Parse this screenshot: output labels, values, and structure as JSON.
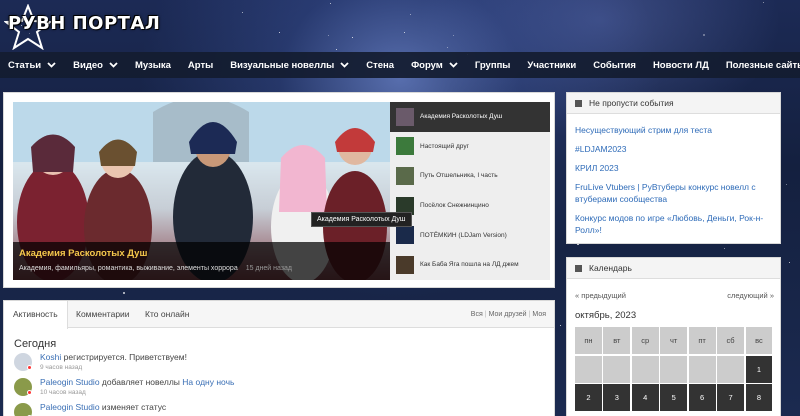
{
  "logo": {
    "text": "РУВН ПОРТАЛ"
  },
  "nav": [
    {
      "label": "Статьи",
      "dropdown": true
    },
    {
      "label": "Видео",
      "dropdown": true
    },
    {
      "label": "Музыка",
      "dropdown": false
    },
    {
      "label": "Арты",
      "dropdown": false
    },
    {
      "label": "Визуальные новеллы",
      "dropdown": true
    },
    {
      "label": "Стена",
      "dropdown": false
    },
    {
      "label": "Форум",
      "dropdown": true
    },
    {
      "label": "Группы",
      "dropdown": false
    },
    {
      "label": "Участники",
      "dropdown": false
    },
    {
      "label": "События",
      "dropdown": false
    },
    {
      "label": "Новости ЛД",
      "dropdown": false
    },
    {
      "label": "Полезные сайты",
      "dropdown": true
    }
  ],
  "slider": {
    "title": "Академия Расколотых Душ",
    "tags": "Академия, фамильяры, романтика, выживание, элементы хоррора",
    "time": "15 дней назад",
    "tooltip": "Академия Расколотых Душ",
    "thumbs": [
      {
        "label": "Академия Расколотых Душ",
        "active": true,
        "color": "#6a5a6a"
      },
      {
        "label": "Настоящий друг",
        "active": false,
        "color": "#3c7a3c"
      },
      {
        "label": "Путь Отшельника, I часть",
        "active": false,
        "color": "#5a6a4a"
      },
      {
        "label": "Посёлок Снежнинцино",
        "active": false,
        "color": "#2a3a2a"
      },
      {
        "label": "ПОТЁМКИН (LDJam Version)",
        "active": false,
        "color": "#1a2a4a"
      },
      {
        "label": "Как Баба Яга пошла на ЛД джем",
        "active": false,
        "color": "#4a3a2a"
      }
    ]
  },
  "activity": {
    "tabs": [
      "Активность",
      "Комментарии",
      "Кто онлайн"
    ],
    "filters": [
      "Вся",
      "Мои друзей",
      "Моя"
    ],
    "heading": "Сегодня",
    "items": [
      {
        "user": "Koshi",
        "action": "регистрируется. Приветствуем!",
        "link": "",
        "ago": "9 часов назад",
        "avatar": "#cfd6e0"
      },
      {
        "user": "Paleogin Studio",
        "action": "добавляет новеллы",
        "link": "На одну ночь",
        "ago": "10 часов назад",
        "avatar": "#8a9a4a"
      },
      {
        "user": "Paleogin Studio",
        "action": "изменяет статус",
        "link": "",
        "ago": "",
        "avatar": "#8a9a4a"
      }
    ]
  },
  "events": {
    "title": "Не пропусти события",
    "items": [
      "Несуществующий стрим для теста",
      "#LDJAM2023",
      "КРИЛ 2023",
      "FruLive Vtubers | РуВтуберы конкурс новелл с втуберами сообщества",
      "Конкурс модов по игре «Любовь, Деньги, Рок-н-Ролл»!"
    ]
  },
  "calendar": {
    "title": "Календарь",
    "prev": "« предыдущий",
    "next": "следующий »",
    "month": "октябрь, 2023",
    "weekdays": [
      "пн",
      "вт",
      "ср",
      "чт",
      "пт",
      "сб",
      "вс"
    ],
    "weeks": [
      [
        "",
        "",
        "",
        "",
        "",
        "",
        "1"
      ],
      [
        "2",
        "3",
        "4",
        "5",
        "6",
        "7",
        "8"
      ]
    ]
  },
  "colors": {
    "accent": "#f5c84c",
    "link": "#2e6bb8",
    "nav_bg": "#141c30"
  }
}
